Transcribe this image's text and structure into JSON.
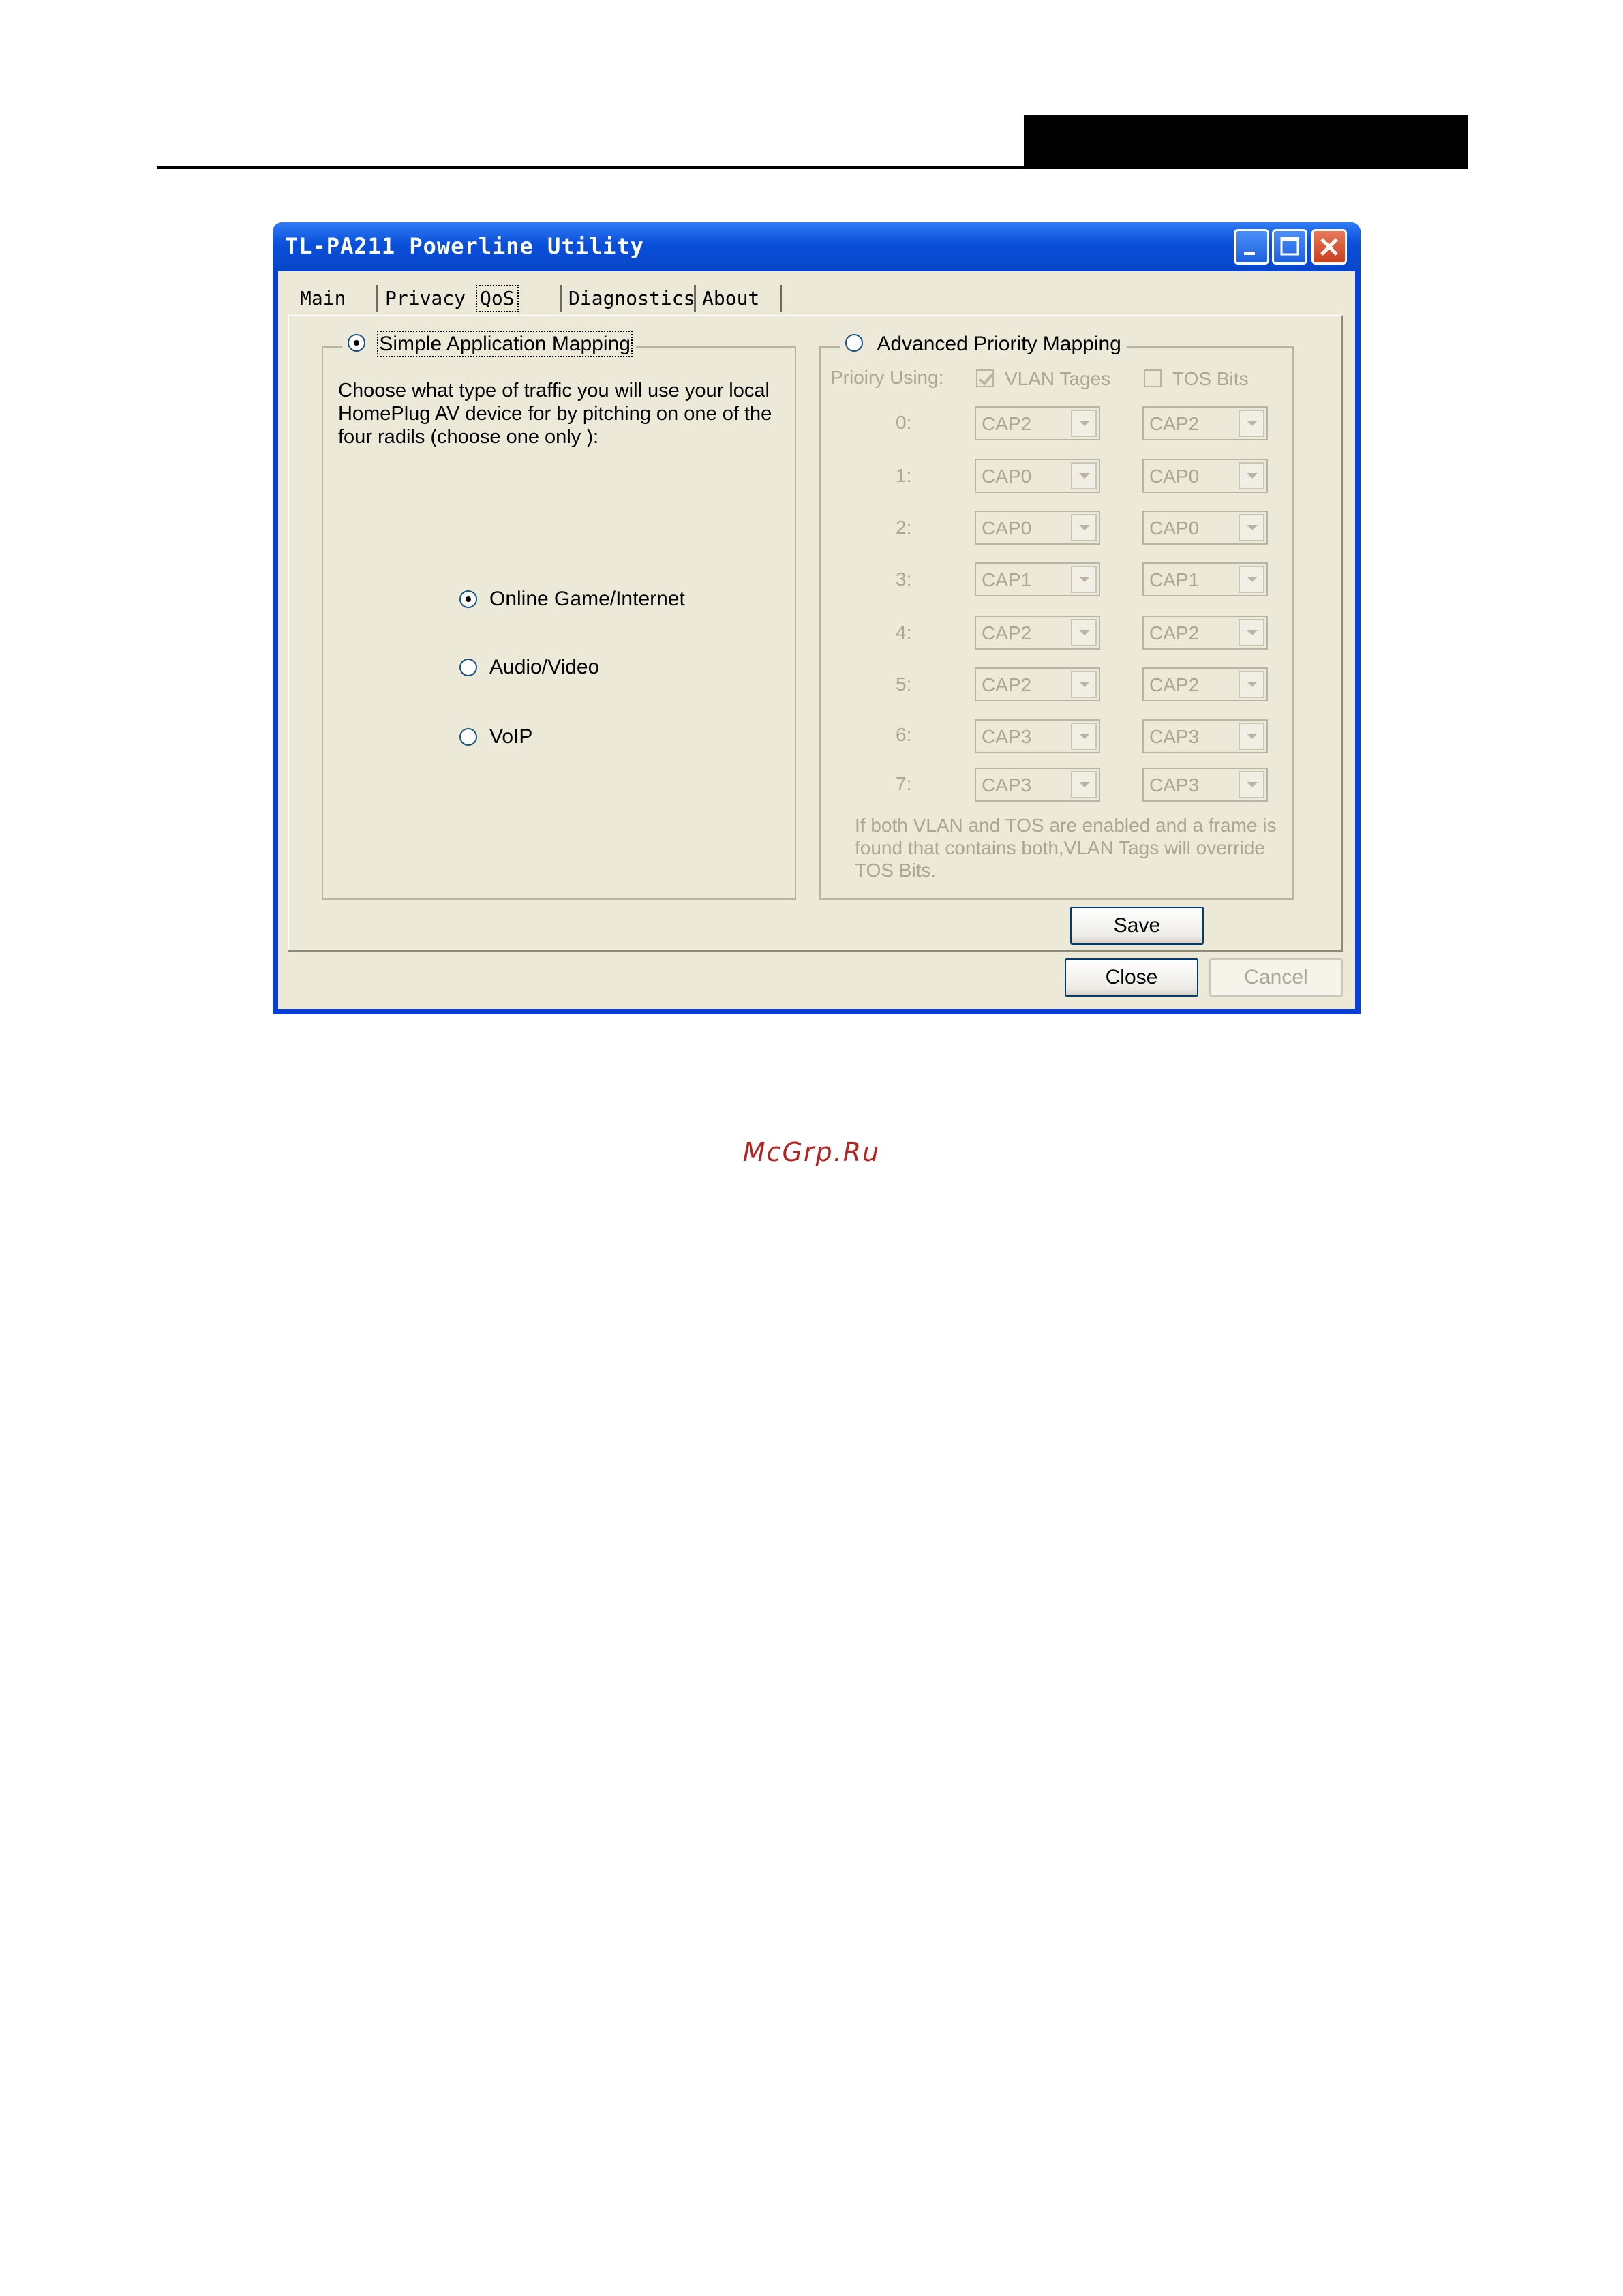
{
  "window": {
    "title": "TL-PA211 Powerline Utility"
  },
  "tabs": [
    {
      "label": "Main"
    },
    {
      "label": "Privacy"
    },
    {
      "label": "QoS"
    },
    {
      "label": "Diagnostics"
    },
    {
      "label": "About"
    }
  ],
  "simple": {
    "legend": "Simple Application Mapping",
    "selected": true,
    "description": "Choose what type of traffic you will use your local HomePlug AV device for by pitching on one of the four radils (choose one only ):",
    "options": [
      {
        "label": "Online Game/Internet",
        "selected": true
      },
      {
        "label": "Audio/Video",
        "selected": false
      },
      {
        "label": "VoIP",
        "selected": false
      }
    ]
  },
  "advanced": {
    "legend": "Advanced Priority Mapping",
    "selected": false,
    "priority_label": "Prioiry Using:",
    "vlan_label": "VLAN Tages",
    "vlan_checked": true,
    "tos_label": "TOS Bits",
    "tos_checked": false,
    "rows": [
      {
        "index": "0:",
        "vlan": "CAP2",
        "tos": "CAP2"
      },
      {
        "index": "1:",
        "vlan": "CAP0",
        "tos": "CAP0"
      },
      {
        "index": "2:",
        "vlan": "CAP0",
        "tos": "CAP0"
      },
      {
        "index": "3:",
        "vlan": "CAP1",
        "tos": "CAP1"
      },
      {
        "index": "4:",
        "vlan": "CAP2",
        "tos": "CAP2"
      },
      {
        "index": "5:",
        "vlan": "CAP2",
        "tos": "CAP2"
      },
      {
        "index": "6:",
        "vlan": "CAP3",
        "tos": "CAP3"
      },
      {
        "index": "7:",
        "vlan": "CAP3",
        "tos": "CAP3"
      }
    ],
    "note": "If both VLAN and TOS are enabled and a frame is found that contains both,VLAN Tags will override TOS Bits."
  },
  "buttons": {
    "save": "Save",
    "close": "Close",
    "cancel": "Cancel"
  },
  "watermark": "McGrp.Ru"
}
